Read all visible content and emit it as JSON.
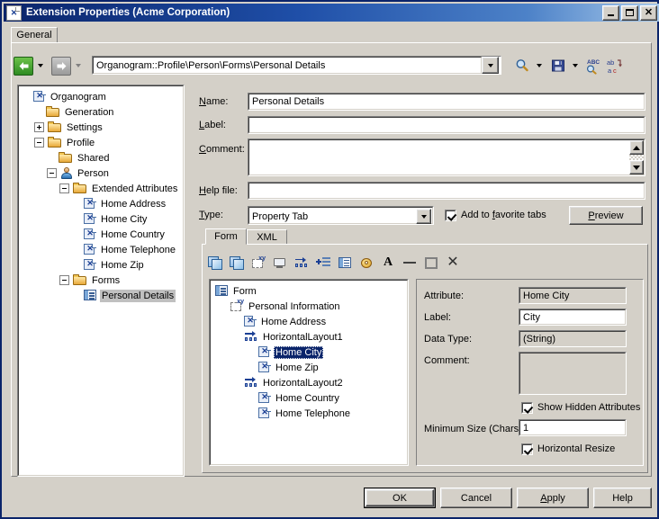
{
  "window": {
    "title": "Extension Properties (Acme Corporation)",
    "icon": "app-icon",
    "buttons": {
      "minimize": "minimize-button",
      "maximize": "maximize-button",
      "close": "close-button"
    }
  },
  "tabs": {
    "general": "General"
  },
  "navbar": {
    "back": "back-button",
    "forward": "forward-button",
    "address": "Organogram::Profile\\Person\\Forms\\Personal Details",
    "tools": [
      "search-icon",
      "save-icon",
      "spell-check-icon",
      "replace-icon"
    ]
  },
  "tree": {
    "items": [
      {
        "label": "Organogram",
        "indent": 0,
        "icon": "attribute-icon",
        "expander": "none",
        "selected": false
      },
      {
        "label": "Generation",
        "indent": 1,
        "icon": "folder-icon",
        "expander": "none",
        "selected": false
      },
      {
        "label": "Settings",
        "indent": 1,
        "icon": "folder-icon",
        "expander": "plus",
        "selected": false
      },
      {
        "label": "Profile",
        "indent": 1,
        "icon": "folder-icon",
        "expander": "minus",
        "selected": false
      },
      {
        "label": "Shared",
        "indent": 2,
        "icon": "folder-icon",
        "expander": "none",
        "selected": false
      },
      {
        "label": "Person",
        "indent": 2,
        "icon": "person-icon",
        "expander": "minus",
        "selected": false
      },
      {
        "label": "Extended Attributes",
        "indent": 3,
        "icon": "folder-icon",
        "expander": "minus",
        "selected": false
      },
      {
        "label": "Home Address",
        "indent": 4,
        "icon": "attribute-icon",
        "expander": "none",
        "selected": false
      },
      {
        "label": "Home City",
        "indent": 4,
        "icon": "attribute-icon",
        "expander": "none",
        "selected": false
      },
      {
        "label": "Home Country",
        "indent": 4,
        "icon": "attribute-icon",
        "expander": "none",
        "selected": false
      },
      {
        "label": "Home Telephone",
        "indent": 4,
        "icon": "attribute-icon",
        "expander": "none",
        "selected": false
      },
      {
        "label": "Home Zip",
        "indent": 4,
        "icon": "attribute-icon",
        "expander": "none",
        "selected": false
      },
      {
        "label": "Forms",
        "indent": 3,
        "icon": "folder-icon",
        "expander": "minus",
        "selected": false
      },
      {
        "label": "Personal Details",
        "indent": 4,
        "icon": "form-icon",
        "expander": "none",
        "selected": true
      }
    ]
  },
  "properties": {
    "name_label": "Name:",
    "name_value": "Personal Details",
    "label_label": "Label:",
    "label_value": "",
    "comment_label": "Comment:",
    "comment_value": "",
    "help_label": "Help file:",
    "help_value": "",
    "type_label": "Type:",
    "type_value": "Property Tab",
    "favorite_label": "Add to favorite tabs",
    "favorite_checked": true,
    "preview_label": "Preview"
  },
  "editor": {
    "tabs": [
      {
        "label": "Form",
        "active": true
      },
      {
        "label": "XML",
        "active": false
      }
    ],
    "toolbar": [
      "copy-form-icon",
      "paste-form-icon",
      "add-container-icon",
      "add-screen-icon",
      "add-horizontal-layout-icon",
      "add-list-icon",
      "add-grid-icon",
      "properties-icon",
      "text-style-icon",
      "separator-icon",
      "group-icon",
      "delete-icon"
    ],
    "tree": [
      {
        "label": "Form",
        "indent": 0,
        "icon": "form-icon",
        "selected": false
      },
      {
        "label": "Personal Information",
        "indent": 1,
        "icon": "container-icon",
        "selected": false
      },
      {
        "label": "Home Address",
        "indent": 2,
        "icon": "attribute-icon",
        "selected": false
      },
      {
        "label": "HorizontalLayout1",
        "indent": 2,
        "icon": "layout-icon",
        "selected": false
      },
      {
        "label": "Home City",
        "indent": 3,
        "icon": "attribute-icon",
        "selected": true
      },
      {
        "label": "Home Zip",
        "indent": 3,
        "icon": "attribute-icon",
        "selected": false
      },
      {
        "label": "HorizontalLayout2",
        "indent": 2,
        "icon": "layout-icon",
        "selected": false
      },
      {
        "label": "Home Country",
        "indent": 3,
        "icon": "attribute-icon",
        "selected": false
      },
      {
        "label": "Home Telephone",
        "indent": 3,
        "icon": "attribute-icon",
        "selected": false
      }
    ],
    "details": {
      "attribute_label": "Attribute:",
      "attribute_value": "Home City",
      "label_label": "Label:",
      "label_value": "City",
      "datatype_label": "Data Type:",
      "datatype_value": "(String)",
      "comment_label": "Comment:",
      "comment_value": "",
      "show_hidden_label": "Show Hidden Attributes",
      "show_hidden_checked": true,
      "min_size_label": "Minimum Size (Chars):",
      "min_size_value": "1",
      "horizontal_resize_label": "Horizontal Resize",
      "horizontal_resize_checked": true
    }
  },
  "footer": {
    "ok": "OK",
    "cancel": "Cancel",
    "apply": "Apply",
    "help": "Help"
  }
}
